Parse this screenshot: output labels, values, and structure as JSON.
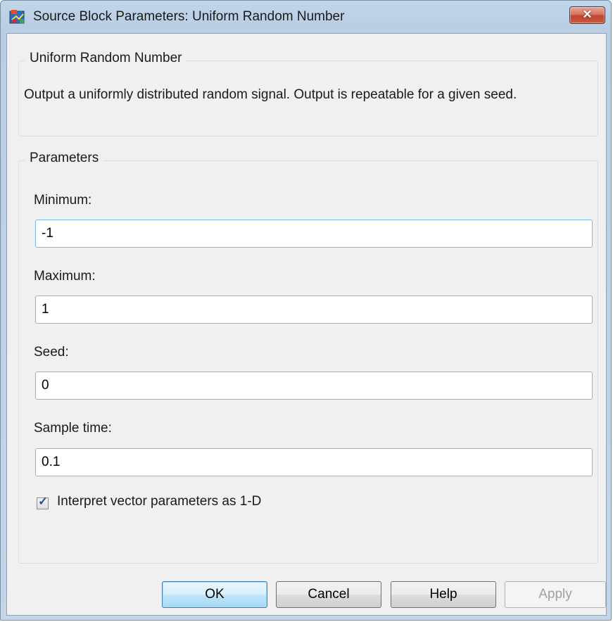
{
  "window": {
    "title": "Source Block Parameters: Uniform Random Number",
    "close_symbol": "✕",
    "icon": "simulink-block-icon"
  },
  "block_group": {
    "title": "Uniform Random Number",
    "description": "Output a uniformly distributed random signal.  Output is repeatable for a given seed."
  },
  "params_group": {
    "title": "Parameters",
    "minimum": {
      "label": "Minimum:",
      "value": "-1"
    },
    "maximum": {
      "label": "Maximum:",
      "value": "1"
    },
    "seed": {
      "label": "Seed:",
      "value": "0"
    },
    "sample_time": {
      "label": "Sample time:",
      "value": "0.1"
    },
    "interpret_vector": {
      "label": "Interpret vector parameters as 1-D",
      "checked": true,
      "check_symbol": "✓"
    }
  },
  "buttons": {
    "ok": "OK",
    "cancel": "Cancel",
    "help": "Help",
    "apply": "Apply"
  }
}
